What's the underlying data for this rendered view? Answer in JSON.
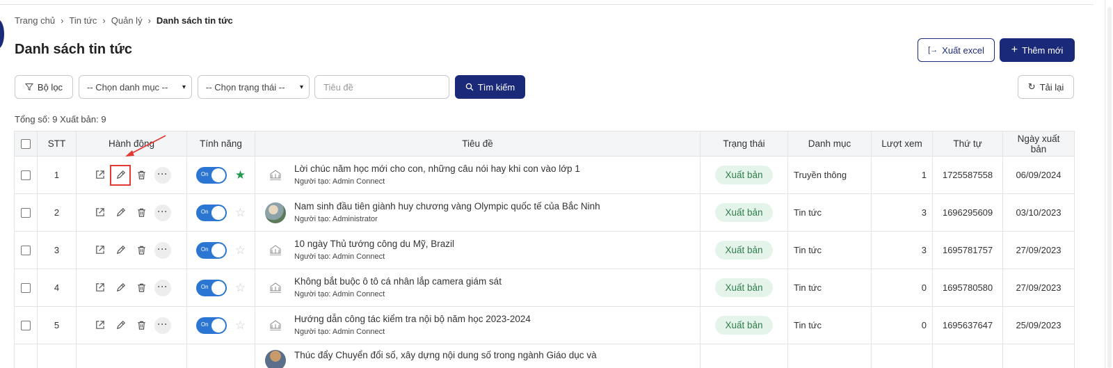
{
  "breadcrumb": {
    "items": [
      "Trang chủ",
      "Tin tức",
      "Quản lý"
    ],
    "current": "Danh sách tin tức"
  },
  "page": {
    "title": "Danh sách tin tức"
  },
  "toolbar": {
    "export_label": "Xuất excel",
    "add_label": "Thêm mới",
    "filter_label": "Bộ lọc",
    "category_select": "-- Chọn danh mục --",
    "status_select": "-- Chọn trạng thái --",
    "title_placeholder": "Tiêu đề",
    "search_label": "Tìm kiếm",
    "reload_label": "Tải lại"
  },
  "summary": {
    "total_label": "Tổng số:",
    "total": "9",
    "published_label": "Xuất bản:",
    "published": "9"
  },
  "table": {
    "headers": [
      "STT",
      "Hành động",
      "Tính năng",
      "Tiêu đề",
      "Trạng thái",
      "Danh mục",
      "Lượt xem",
      "Thứ tự",
      "Ngày xuất bản"
    ],
    "toggle_label": "On",
    "rows": [
      {
        "stt": "1",
        "title": "Lời chúc năm học mới cho con, những câu nói hay khi con vào lớp 1",
        "author": "Người tạo: Admin Connect",
        "status": "Xuất bản",
        "category": "Truyền thông",
        "views": "1",
        "order": "1725587558",
        "date": "06/09/2024",
        "featured": true,
        "thumb": "logo"
      },
      {
        "stt": "2",
        "title": "Nam sinh đầu tiên giành huy chương vàng Olympic quốc tế của Bắc Ninh",
        "author": "Người tạo: Administrator",
        "status": "Xuất bản",
        "category": "Tin tức",
        "views": "3",
        "order": "1696295609",
        "date": "03/10/2023",
        "featured": false,
        "thumb": "photo"
      },
      {
        "stt": "3",
        "title": "10 ngày Thủ tướng công du Mỹ, Brazil",
        "author": "Người tạo: Admin Connect",
        "status": "Xuất bản",
        "category": "Tin tức",
        "views": "3",
        "order": "1695781757",
        "date": "27/09/2023",
        "featured": false,
        "thumb": "logo"
      },
      {
        "stt": "4",
        "title": "Không bắt buộc ô tô cá nhân lắp camera giám sát",
        "author": "Người tạo: Admin Connect",
        "status": "Xuất bản",
        "category": "Tin tức",
        "views": "0",
        "order": "1695780580",
        "date": "27/09/2023",
        "featured": false,
        "thumb": "logo"
      },
      {
        "stt": "5",
        "title": "Hướng dẫn công tác kiểm tra nội bộ năm học 2023-2024",
        "author": "Người tạo: Admin Connect",
        "status": "Xuất bản",
        "category": "Tin tức",
        "views": "0",
        "order": "1695637647",
        "date": "25/09/2023",
        "featured": false,
        "thumb": "logo"
      }
    ],
    "partial_row_title": "Thúc đẩy Chuyển đổi số, xây dựng nội dung số trong ngành Giáo dục và"
  },
  "colors": {
    "primary": "#1b2a78",
    "toggle": "#2a76d2",
    "badge_bg": "#e5f4ea",
    "badge_text": "#2e7d4a",
    "star_on": "#1f9a4e",
    "annotation": "#e53935"
  }
}
